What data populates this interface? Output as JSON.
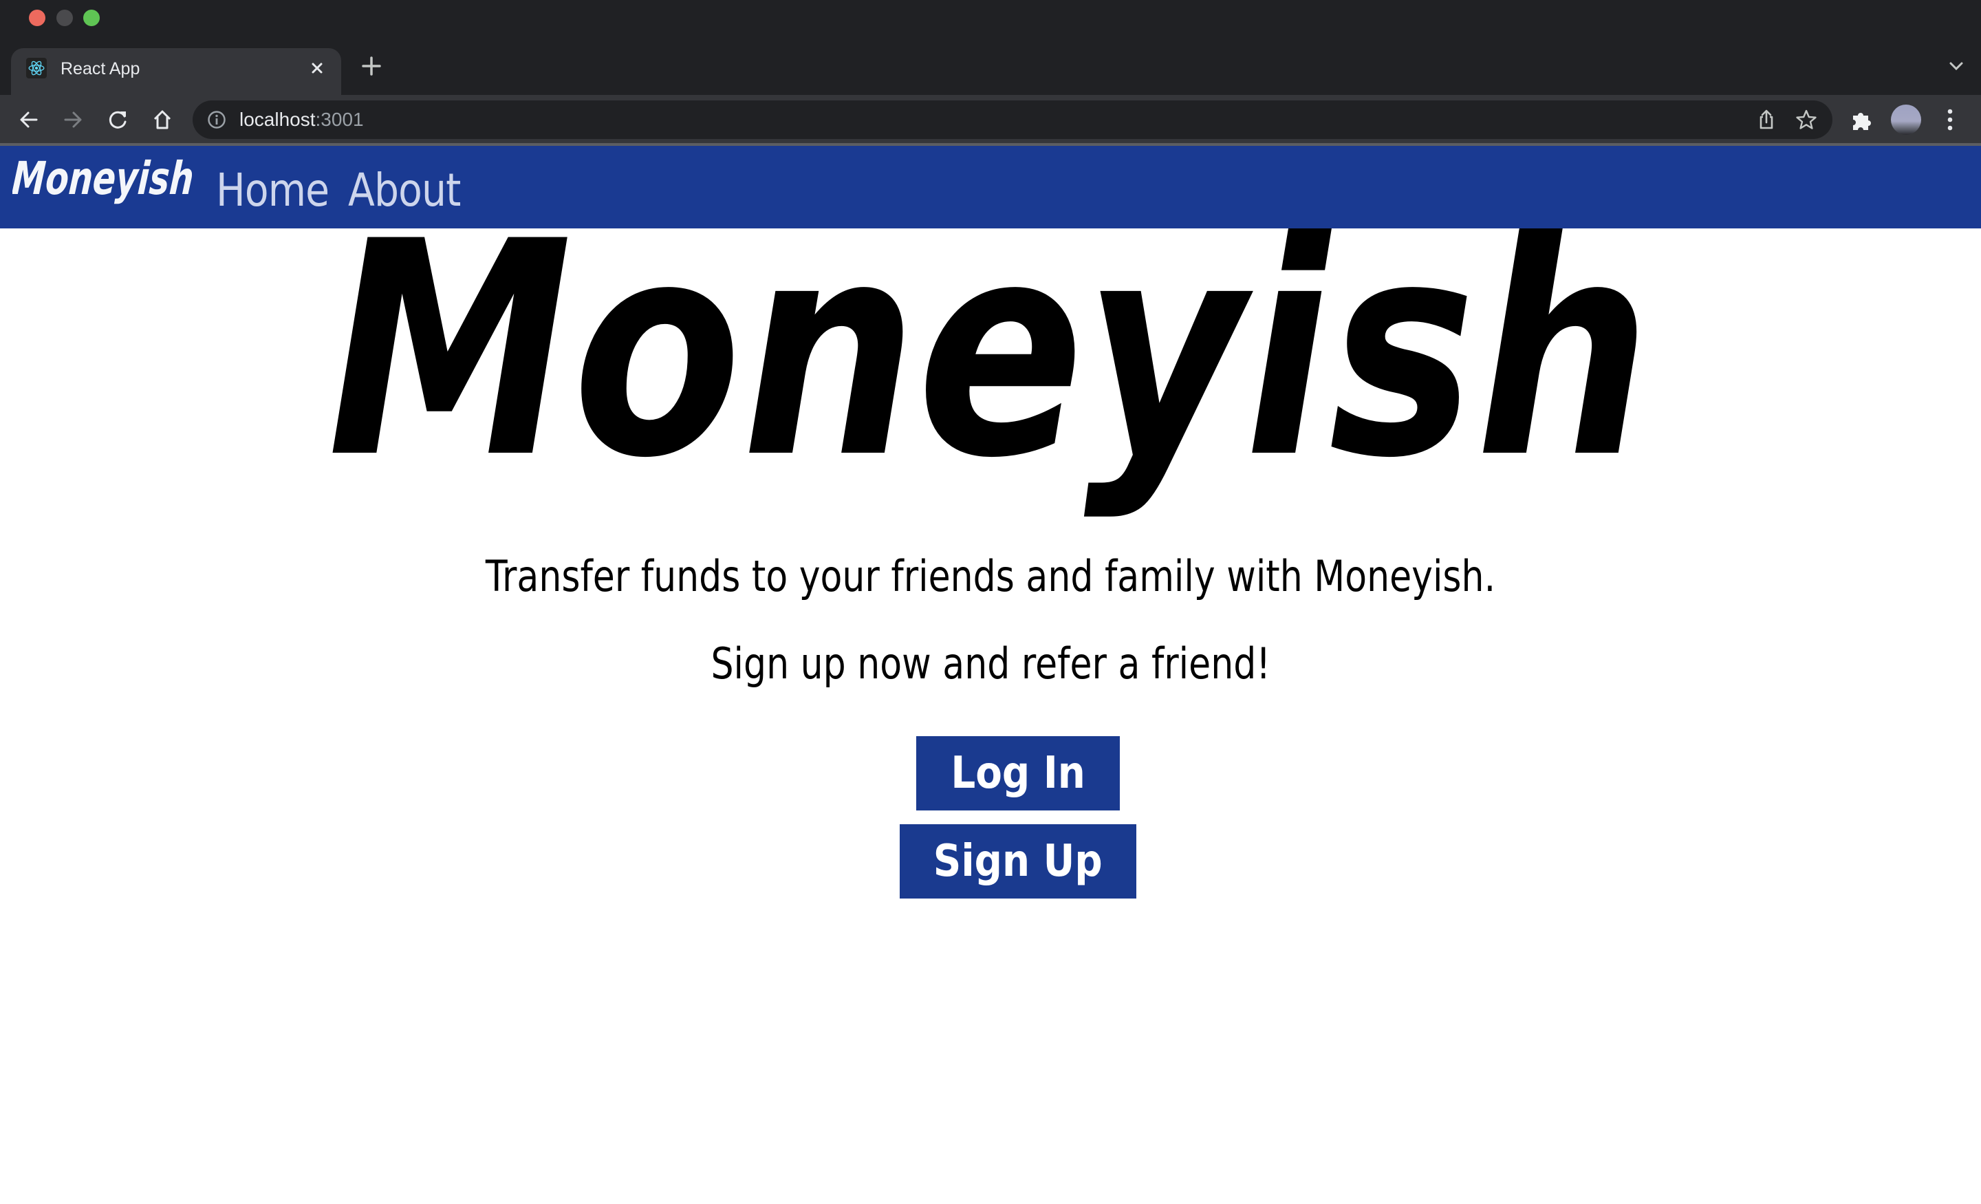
{
  "browser": {
    "tab": {
      "title": "React App",
      "favicon_icon": "react-logo-icon",
      "close_icon": "close-icon"
    },
    "new_tab_icon": "plus-icon",
    "tab_search_icon": "chevron-down-icon",
    "toolbar": {
      "back_icon": "arrow-left-icon",
      "forward_icon": "arrow-right-icon",
      "reload_icon": "reload-icon",
      "home_icon": "home-icon"
    },
    "omnibox": {
      "info_icon": "info-icon",
      "host": "localhost",
      "port": ":3001",
      "share_icon": "share-icon",
      "bookmark_icon": "star-icon"
    },
    "extensions_icon": "puzzle-icon",
    "profile_icon": "avatar",
    "menu_icon": "kebab-menu-icon"
  },
  "site": {
    "brand": "Moneyish",
    "nav": {
      "home": "Home",
      "about": "About"
    },
    "hero_logo_text": "Moneyish",
    "taglines": [
      "Transfer funds to your friends and family with Moneyish.",
      "Sign up now and refer a friend!"
    ],
    "buttons": {
      "login": "Log In",
      "signup": "Sign Up"
    },
    "colors": {
      "brand_blue": "#1a3a92",
      "nav_link": "#cdd5ec",
      "button_text": "#ffffff"
    }
  }
}
